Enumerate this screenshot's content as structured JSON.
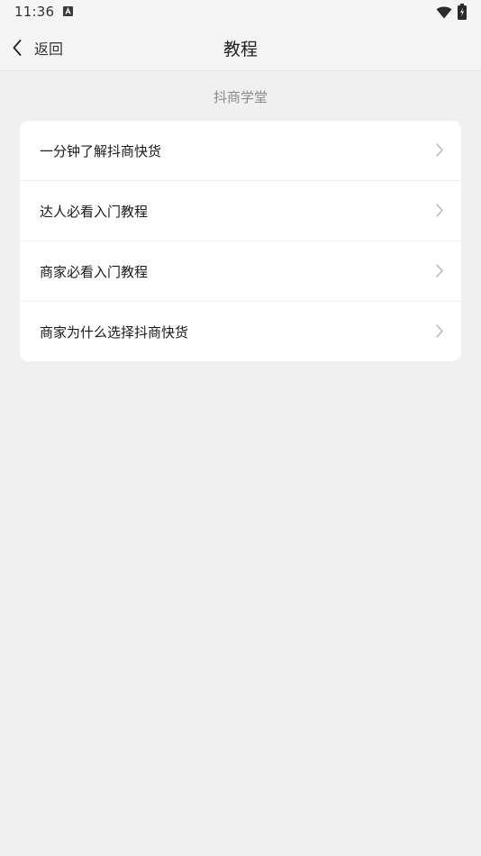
{
  "status_bar": {
    "time": "11:36"
  },
  "header": {
    "back_label": "返回",
    "title": "教程"
  },
  "section": {
    "title": "抖商学堂"
  },
  "tutorials": {
    "items": [
      {
        "label": "一分钟了解抖商快货"
      },
      {
        "label": "达人必看入门教程"
      },
      {
        "label": "商家必看入门教程"
      },
      {
        "label": "商家为什么选择抖商快货"
      }
    ]
  },
  "colors": {
    "page_background": "#f0f0f0",
    "card_background": "#ffffff",
    "section_title": "#8a8a8a",
    "chevron": "#b5b5b5"
  }
}
